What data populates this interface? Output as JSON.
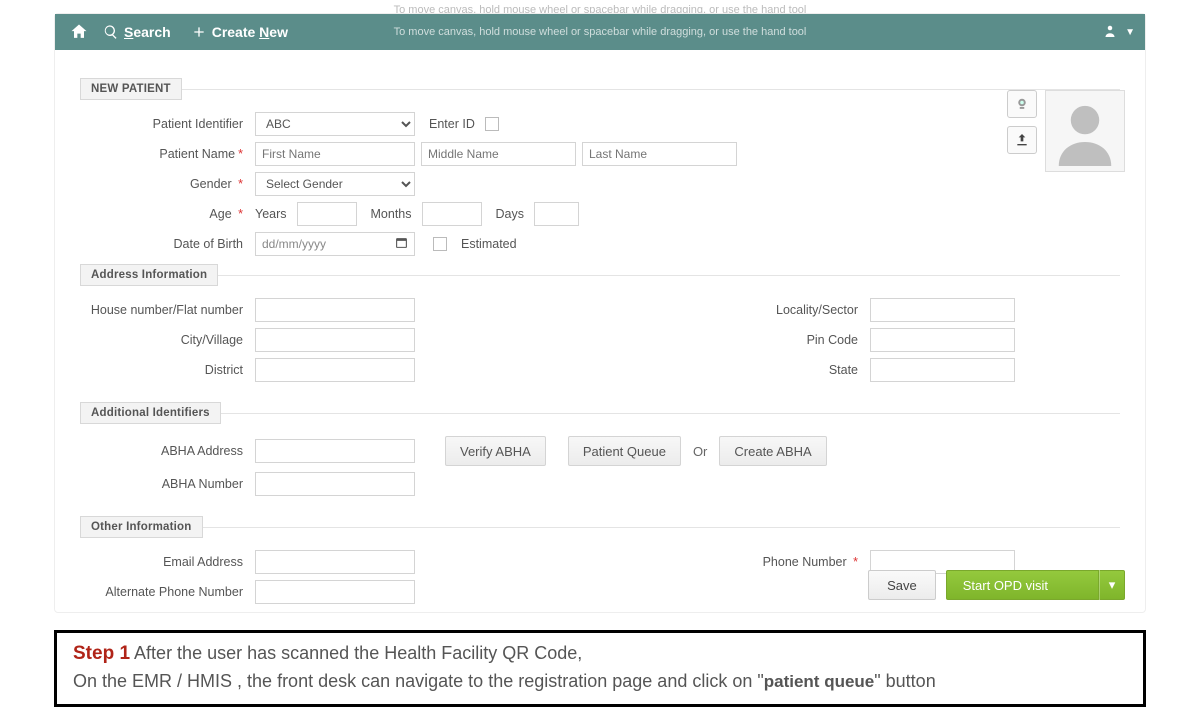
{
  "canvas_hint": "To move canvas, hold mouse wheel or spacebar while dragging, or use the hand tool",
  "topbar": {
    "search_label": "Search",
    "create_label": "Create New"
  },
  "legend": {
    "new_patient": "NEW PATIENT",
    "address": "Address Information",
    "additional_ids": "Additional Identifiers",
    "other_info": "Other Information"
  },
  "labels": {
    "patient_identifier": "Patient Identifier",
    "patient_name": "Patient Name",
    "gender": "Gender",
    "age": "Age",
    "dob": "Date of Birth",
    "enter_id": "Enter ID",
    "years": "Years",
    "months": "Months",
    "days": "Days",
    "estimated": "Estimated",
    "house_no": "House number/Flat number",
    "city": "City/Village",
    "district": "District",
    "locality": "Locality/Sector",
    "pincode": "Pin Code",
    "state": "State",
    "abha_address": "ABHA Address",
    "abha_number": "ABHA Number",
    "email": "Email Address",
    "alt_phone": "Alternate Phone Number",
    "phone": "Phone Number",
    "or": "Or"
  },
  "placeholders": {
    "first_name": "First Name",
    "middle_name": "Middle Name",
    "last_name": "Last Name",
    "dob": "dd/mm/yyyy"
  },
  "selects": {
    "identifier_value": "ABC",
    "gender_value": "Select Gender"
  },
  "buttons": {
    "verify_abha": "Verify ABHA",
    "patient_queue": "Patient Queue",
    "create_abha": "Create ABHA",
    "save": "Save",
    "start_opd": "Start OPD visit"
  },
  "instruction": {
    "step": "Step 1",
    "line1_rest": " After the user has scanned the Health Facility QR Code,",
    "line2_a": "On the EMR / HMIS , the front desk can navigate to the registration page and click on \"",
    "line2_pq": "patient queue",
    "line2_b": "\" button"
  }
}
